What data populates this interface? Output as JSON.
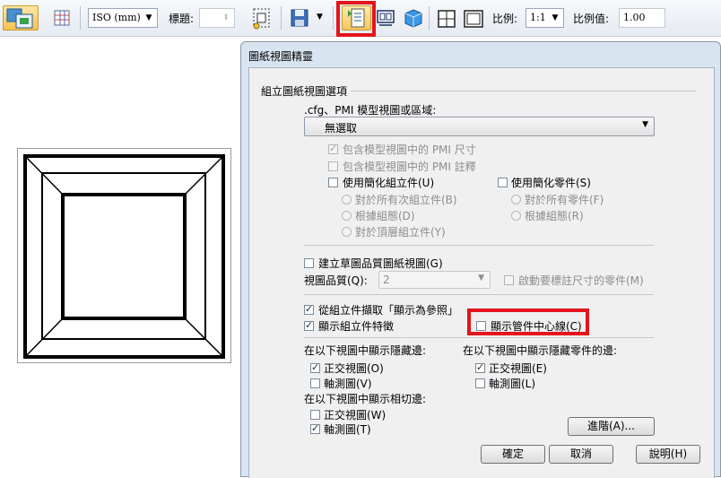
{
  "toolbar": {
    "standard": "ISO (mm)",
    "title_label": "標題:",
    "scale_label": "比例:",
    "scale_value": "1:1",
    "scale_value_label": "比例值:",
    "scale_value_field": "1.00"
  },
  "dialog": {
    "title": "圖紙視圖精靈",
    "section_title": "組立圖紙視圖選項",
    "cfg_label": ".cfg、PMI 模型視圖或區域:",
    "cfg_value": "無選取",
    "pmi_dim": "包含模型視圖中的 PMI 尺寸",
    "pmi_note": "包含模型視圖中的 PMI 註釋",
    "use_simplified_assembly": "使用簡化組立件(U)",
    "all_subassemblies": "對於所有次組立件(B)",
    "by_config_1": "根據組態(D)",
    "top_level": "對於頂層組立件(Y)",
    "use_simplified_parts": "使用簡化零件(S)",
    "all_parts": "對於所有零件(F)",
    "by_config_2": "根據組態(R)",
    "draft_quality": "建立草圖品質圖紙視圖(G)",
    "view_quality_label": "視圖品質(Q):",
    "view_quality_value": "2",
    "dim_parts": "啟動要標註尺寸的零件(M)",
    "show_reference": "從組立件擷取「顯示為參照」",
    "show_features": "顯示組立件特徵",
    "show_centerline": "顯示管件中心線(C)",
    "hidden_edges_title": "在以下視圖中顯示隱藏邊:",
    "hidden_ortho": "正交視圖(O)",
    "hidden_iso": "軸測圖(V)",
    "hidden_parts_title": "在以下視圖中顯示隱藏零件的邊:",
    "parts_ortho": "正交視圖(E)",
    "parts_iso": "軸測圖(L)",
    "tangent_title": "在以下視圖中顯示相切邊:",
    "tangent_ortho": "正交視圖(W)",
    "tangent_iso": "軸測圖(T)",
    "advanced_button": "進階(A)...",
    "ok_button": "確定",
    "cancel_button": "取消",
    "help_button": "說明(H)"
  }
}
